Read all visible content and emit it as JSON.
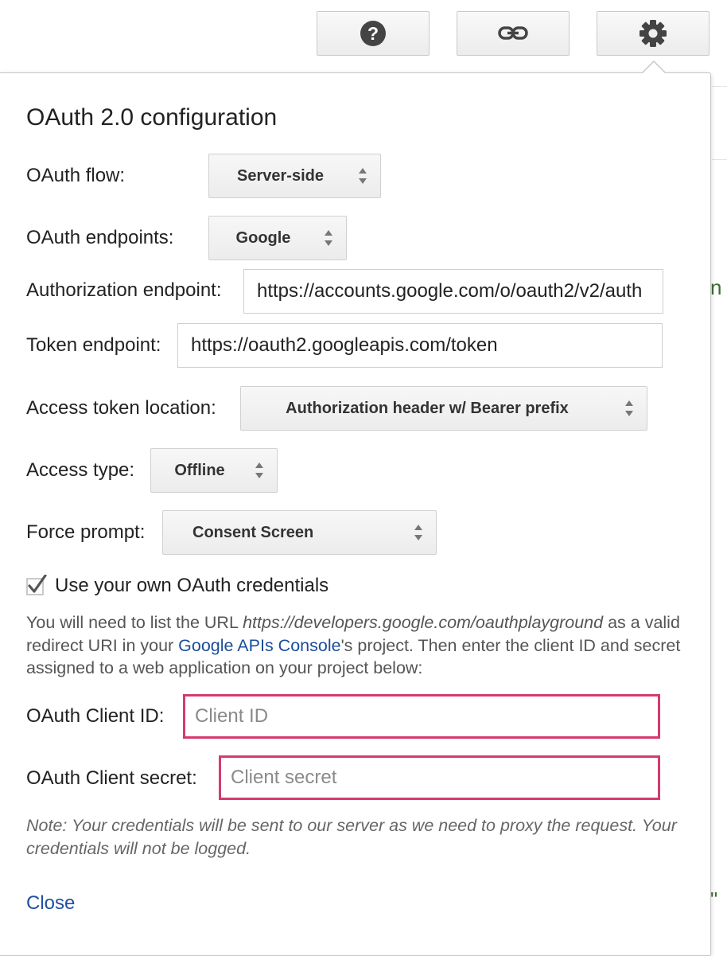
{
  "toolbar": {
    "help_icon": "question-circle-icon",
    "link_icon": "link-icon",
    "settings_icon": "gear-icon"
  },
  "background": {
    "fragment_1": "n",
    "fragment_2": "\""
  },
  "panel": {
    "title": "OAuth 2.0 configuration",
    "oauth_flow": {
      "label": "OAuth flow:",
      "value": "Server-side"
    },
    "oauth_endpoints": {
      "label": "OAuth endpoints:",
      "value": "Google"
    },
    "authorization_endpoint": {
      "label": "Authorization endpoint:",
      "value": "https://accounts.google.com/o/oauth2/v2/auth"
    },
    "token_endpoint": {
      "label": "Token endpoint:",
      "value": "https://oauth2.googleapis.com/token"
    },
    "access_token_location": {
      "label": "Access token location:",
      "value": "Authorization header w/ Bearer prefix"
    },
    "access_type": {
      "label": "Access type:",
      "value": "Offline"
    },
    "force_prompt": {
      "label": "Force prompt:",
      "value": "Consent Screen"
    },
    "own_credentials": {
      "label": "Use your own OAuth credentials",
      "checked": true
    },
    "help": {
      "text_1": "You will need to list the URL ",
      "url": "https://developers.google.com/oauthplayground",
      "text_2": " as a valid redirect URI in your ",
      "link": "Google APIs Console",
      "text_3": "'s project. Then enter the client ID and secret assigned to a web application on your project below:"
    },
    "client_id": {
      "label": "OAuth Client ID:",
      "placeholder": "Client ID",
      "value": ""
    },
    "client_secret": {
      "label": "OAuth Client secret:",
      "placeholder": "Client secret",
      "value": ""
    },
    "note": "Note: Your credentials will be sent to our server as we need to proxy the request. Your credentials will not be logged.",
    "close_label": "Close"
  },
  "colors": {
    "error_border": "#d63a6c",
    "link": "#1f4f9f"
  }
}
